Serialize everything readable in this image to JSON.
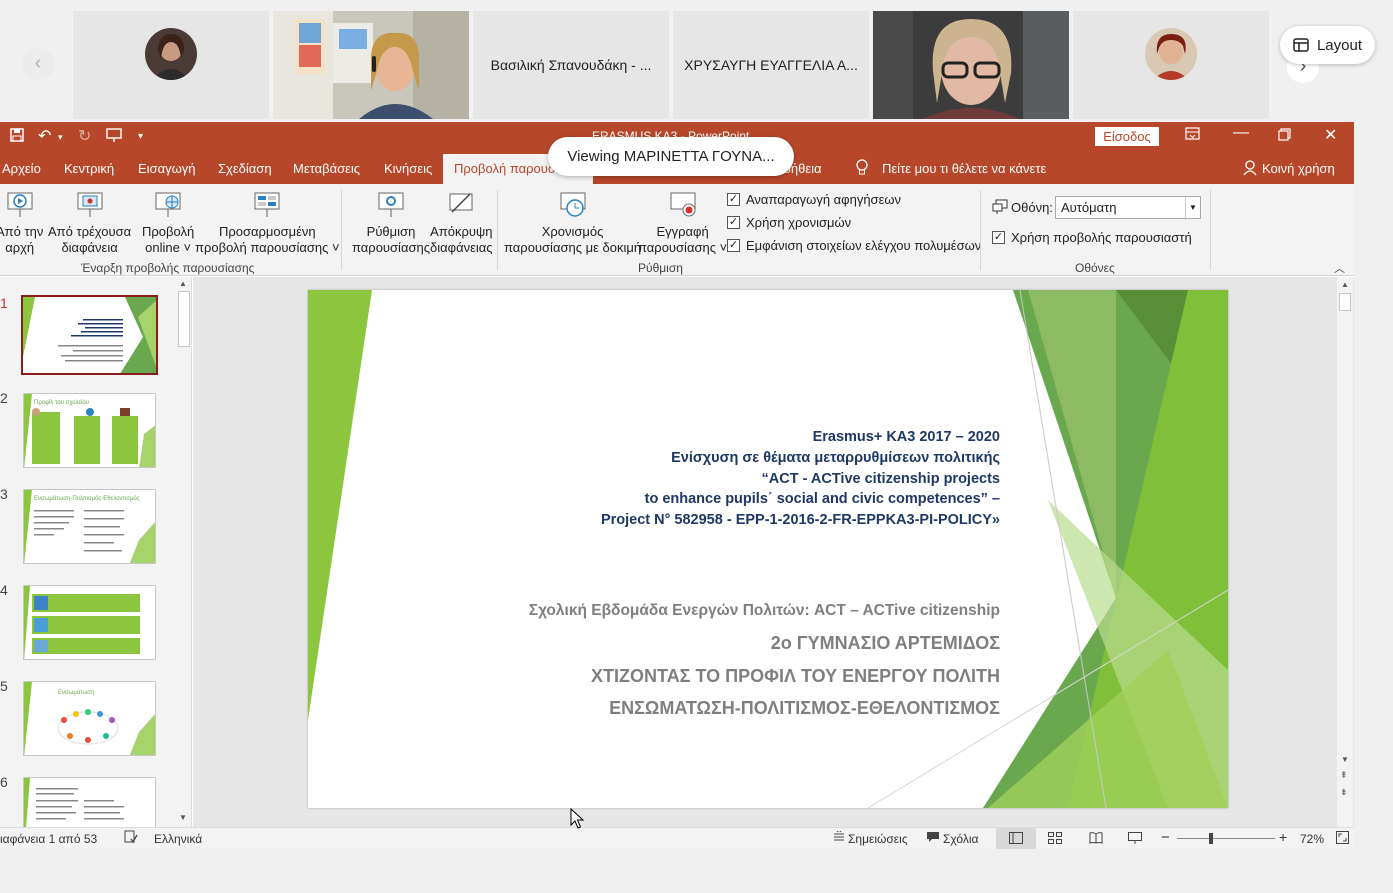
{
  "meeting": {
    "participants": [
      {
        "name": "",
        "type": "avatar"
      },
      {
        "name": "",
        "type": "video"
      },
      {
        "name": "Βασιλική Σπανουδάκη - ...",
        "type": "name"
      },
      {
        "name": "ΧΡΥΣΑΥΓΗ ΕΥΑΓΓΕΛΙΑ Α...",
        "type": "name"
      },
      {
        "name": "",
        "type": "video"
      },
      {
        "name": "",
        "type": "avatar"
      }
    ],
    "layout_label": "Layout",
    "viewing_banner": "Viewing ΜΑΡΙΝΕΤΤΑ ΓΟΥΝΑ..."
  },
  "titlebar": {
    "title": "ERASMUS KA3 - PowerPoint",
    "signin": "Είσοδος"
  },
  "tabs": [
    "Αρχείο",
    "Κεντρική",
    "Εισαγωγή",
    "Σχεδίαση",
    "Μεταβάσεις",
    "Κινήσεις",
    "Προβολή παρουσίασης",
    "Βοήθεια"
  ],
  "active_tab": "Προβολή παρουσίασης",
  "tell_me": "Πείτε μου τι θέλετε να κάνετε",
  "share": "Κοινή χρήση",
  "ribbon": {
    "start_group": {
      "label": "Έναρξη προβολής παρουσίασης",
      "from_start_1": "Από την",
      "from_start_2": "αρχή",
      "from_current_1": "Από τρέχουσα",
      "from_current_2": "διαφάνεια",
      "online_1": "Προβολή",
      "online_2": "online ˅",
      "custom_1": "Προσαρμοσμένη",
      "custom_2": "προβολή παρουσίασης ˅"
    },
    "setup_group": {
      "label": "Ρύθμιση",
      "setup_1": "Ρύθμιση",
      "setup_2": "παρουσίασης",
      "hide_1": "Απόκρυψη",
      "hide_2": "διαφάνειας",
      "rehearse_1": "Χρονισμός",
      "rehearse_2": "παρουσίασης με δοκιμή",
      "record_1": "Εγγραφή",
      "record_2": "παρουσίασης ˅",
      "chk_narrations": "Αναπαραγωγή αφηγήσεων",
      "chk_timings": "Χρήση χρονισμών",
      "chk_media": "Εμφάνιση στοιχείων ελέγχου πολυμέσων"
    },
    "monitors_group": {
      "label": "Οθόνες",
      "monitor_label": "Οθόνη:",
      "monitor_value": "Αυτόματη",
      "presenter_view": "Χρήση προβολής παρουσιαστή"
    }
  },
  "thumbnails": [
    {
      "num": "1",
      "title": ""
    },
    {
      "num": "2",
      "title": "Προφίλ του σχολείου"
    },
    {
      "num": "3",
      "title": "Ενσωμάτωση-Πολιτισμός-Εθελοντισμός"
    },
    {
      "num": "4",
      "title": ""
    },
    {
      "num": "5",
      "title": "Ενσωμάτωση"
    },
    {
      "num": "6",
      "title": ""
    }
  ],
  "slide": {
    "lines_blue": [
      "Erasmus+ KA3 2017 – 2020",
      "Ενίσχυση σε θέματα μεταρρυθμίσεων πολιτικής",
      "“ACT - ACTive citizenship projects",
      "to enhance pupils΄ social and civic competences” –",
      "Project N° 582958 - EPP-1-2016-2-FR-EPPKA3-PI-POLICY»"
    ],
    "line_week": "Σχολική Εβδομάδα Ενεργών Πολιτών: ACT – ACTive citizenship",
    "line_school": "2ο ΓΥΜΝΑΣΙΟ ΑΡΤΕΜΙΔΟΣ",
    "line_profile": "ΧΤΙΖΟΝΤΑΣ ΤΟ ΠΡΟΦΙΛ ΤΟΥ ΕΝΕΡΓΟΥ ΠΟΛΙΤΗ",
    "line_themes": "ΕΝΣΩΜΑΤΩΣΗ-ΠΟΛΙΤΙΣΜΟΣ-ΕΘΕΛΟΝΤΙΣΜΟΣ"
  },
  "statusbar": {
    "slide_count": "ιαφάνεια 1 από 53",
    "language": "Ελληνικά",
    "notes": "Σημειώσεις",
    "comments": "Σχόλια",
    "zoom": "72%",
    "zoom_level": 0.72
  },
  "colors": {
    "ppt_accent": "#b7472a",
    "slide_title_blue": "#1f3864",
    "slide_green": "#8cc63f"
  }
}
